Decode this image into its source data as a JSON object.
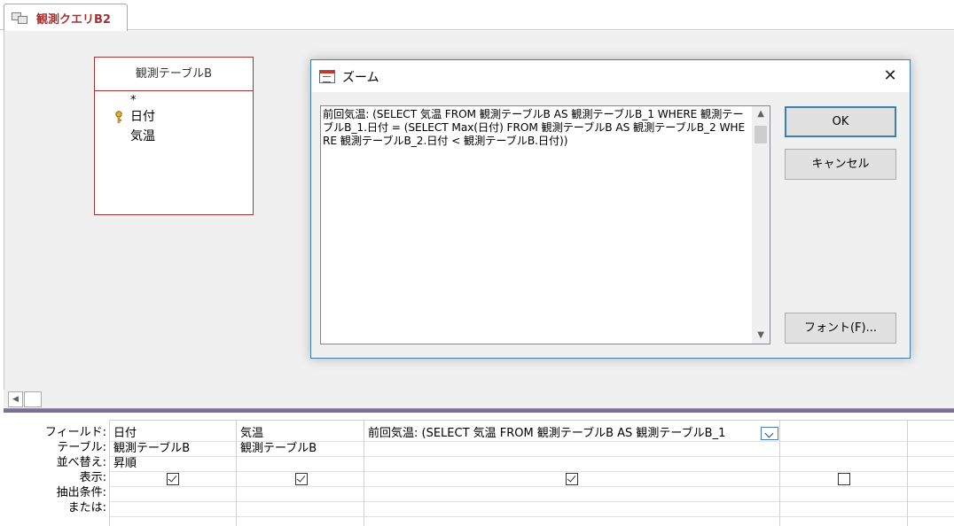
{
  "tab": {
    "title": "観測クエリB2"
  },
  "table_box": {
    "title": "観測テーブルB",
    "fields": [
      "*",
      "日付",
      "気温"
    ]
  },
  "grid": {
    "row_labels": [
      "フィールド:",
      "テーブル:",
      "並べ替え:",
      "表示:",
      "抽出条件:",
      "または:"
    ],
    "columns": [
      {
        "field": "日付",
        "table": "観測テーブルB",
        "sort": "昇順",
        "show": true
      },
      {
        "field": "気温",
        "table": "観測テーブルB",
        "sort": "",
        "show": true
      },
      {
        "field": "前回気温: (SELECT 気温 FROM 観測テーブルB AS 観測テーブルB_1",
        "table": "",
        "sort": "",
        "show": true
      },
      {
        "field": "",
        "table": "",
        "sort": "",
        "show": false
      }
    ]
  },
  "zoom_dialog": {
    "title": "ズーム",
    "close_glyph": "✕",
    "text": "前回気温: (SELECT 気温 FROM 観測テーブルB AS 観測テーブルB_1 WHERE 観測テーブルB_1.日付 = (SELECT Max(日付) FROM 観測テーブルB AS 観測テーブルB_2 WHERE 観測テーブルB_2.日付 < 観測テーブルB.日付))",
    "ok_label": "OK",
    "cancel_label": "キャンセル",
    "font_label": "フォント(F)..."
  },
  "scroll": {
    "up_glyph": "▲",
    "down_glyph": "▼",
    "left_glyph": "◀"
  },
  "colors": {
    "accent": "#3c7fb1",
    "table_border": "#a33234",
    "splitter": "#7d6f9c"
  }
}
